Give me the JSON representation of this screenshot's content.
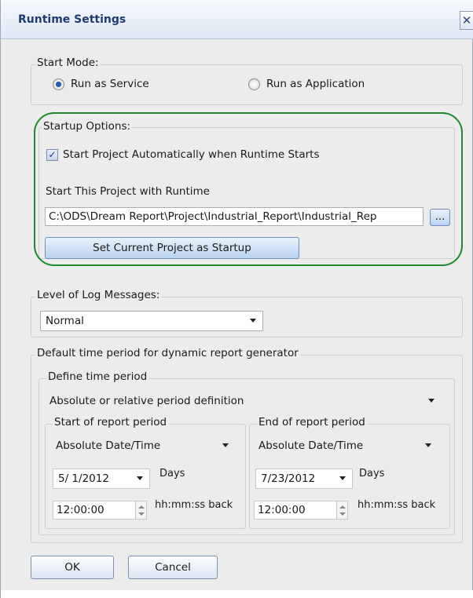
{
  "window": {
    "title": "Runtime Settings",
    "close_glyph": "✕"
  },
  "start_mode": {
    "legend": "Start Mode:",
    "options": [
      {
        "label": "Run as Service",
        "selected": true
      },
      {
        "label": "Run as Application",
        "selected": false
      }
    ]
  },
  "startup_options": {
    "legend": "Startup Options:",
    "auto_start_label": "Start Project Automatically when Runtime Starts",
    "auto_start_checked": true,
    "start_with_runtime_label": "Start This Project with Runtime",
    "project_path": "C:\\ODS\\Dream Report\\Project\\Industrial_Report\\Industrial_Rep",
    "browse_label": "...",
    "set_current_label": "Set Current Project as Startup"
  },
  "log_level": {
    "legend": "Level of Log Messages:",
    "selected": "Normal"
  },
  "default_period": {
    "legend": "Default time period for dynamic report generator",
    "define_legend": "Define time period",
    "definition_selected": "Absolute or relative period definition",
    "start": {
      "legend": "Start of report period",
      "mode": "Absolute Date/Time",
      "date": "5/ 1/2012",
      "days_label": "Days",
      "time": "12:00:00",
      "back_label": "hh:mm:ss back"
    },
    "end": {
      "legend": "End of report period",
      "mode": "Absolute Date/Time",
      "date": "7/23/2012",
      "days_label": "Days",
      "time": "12:00:00",
      "back_label": "hh:mm:ss back"
    }
  },
  "footer": {
    "ok_label": "OK",
    "cancel_label": "Cancel"
  },
  "colors": {
    "title_text": "#1f3b73",
    "highlight_ring": "#1b8a2a"
  }
}
